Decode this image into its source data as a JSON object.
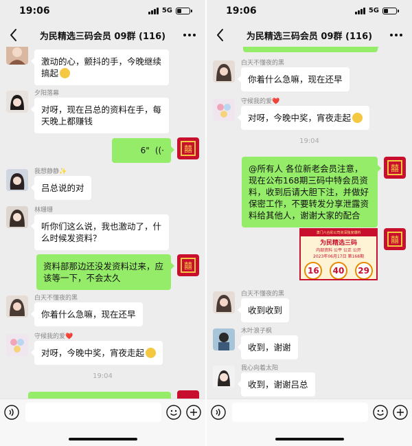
{
  "status_bar": {
    "time": "19:06",
    "network": "5G"
  },
  "chat": {
    "title": "为民精选三码会员 09群 (116)"
  },
  "colors": {
    "chat_bg": "#ededed",
    "outgoing_bubble": "#95ec69",
    "incoming_bubble": "#ffffff",
    "poster_red": "#c8102e"
  },
  "icons": {
    "back": "chevron-left-icon",
    "more": "more-dots-icon",
    "voice": "voice-icon",
    "emoji": "emoji-icon",
    "plus": "plus-icon"
  },
  "left": {
    "messages": [
      {
        "sender": "",
        "text": "激动的心，颤抖的手，今晚继续搞起"
      },
      {
        "sender": "夕阳落幕",
        "text": "对呀，现在吕总的资料在手，每天晚上都赚钱"
      },
      {
        "voice_duration": "6\""
      },
      {
        "sender": "我想静静✨",
        "text": "吕总说的对"
      },
      {
        "sender": "林珊珊",
        "text": "听你们这么说，我也激动了，什么时候发资料？"
      },
      {
        "text": "资料部那边还没发资料过来，应该等一下，不会太久"
      },
      {
        "sender": "白天不懂夜的黑",
        "text": "你着什么急嘛，现在还早"
      },
      {
        "sender": "守候我的爱❤️",
        "text": "对呀，今晚中奖，宵夜走起"
      }
    ],
    "time_separator": "19:04"
  },
  "right": {
    "messages": [
      {
        "sender": "白天不懂夜的黑",
        "text": "你着什么急嘛，现在还早"
      },
      {
        "sender": "守候我的爱❤️",
        "text": "对呀，今晚中奖，宵夜走起"
      },
      {
        "text": "@所有人  各位新老会员注意，现在公布168期三码中特会员资料，收到后请大胆下注，并做好保密工作，不要转发分享泄露资料给其他人，谢谢大家的配合"
      },
      {
        "sender": "白天不懂夜的黑",
        "text": "收到收到"
      },
      {
        "sender": "木叶浪子枫",
        "text": "收到，谢谢"
      },
      {
        "sender": "我心向着太阳",
        "text": "收到，谢谢吕总"
      }
    ],
    "time_separator": "19:04",
    "poster": {
      "header": "澳门六合彩公司资深独家爆料",
      "title": "为民精选三码",
      "subtitle": "内部资料 公平 公正 公开",
      "issue": "2023年06月17日 第168期",
      "numbers": [
        "16",
        "40",
        "29"
      ]
    }
  }
}
